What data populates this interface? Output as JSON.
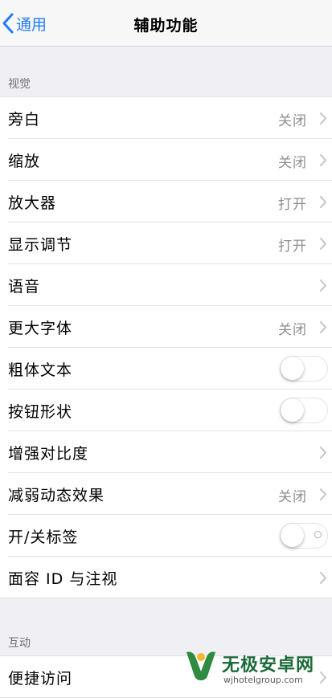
{
  "navbar": {
    "back_label": "通用",
    "title": "辅助功能"
  },
  "sections": {
    "vision_header": "视觉",
    "interaction_header": "互动"
  },
  "vision_rows": [
    {
      "label": "旁白",
      "value": "关闭",
      "accessory": "chevron"
    },
    {
      "label": "缩放",
      "value": "关闭",
      "accessory": "chevron"
    },
    {
      "label": "放大器",
      "value": "打开",
      "accessory": "chevron"
    },
    {
      "label": "显示调节",
      "value": "打开",
      "accessory": "chevron"
    },
    {
      "label": "语音",
      "value": "",
      "accessory": "chevron"
    },
    {
      "label": "更大字体",
      "value": "关闭",
      "accessory": "chevron"
    },
    {
      "label": "粗体文本",
      "value": "",
      "accessory": "toggle",
      "on": false
    },
    {
      "label": "按钮形状",
      "value": "",
      "accessory": "toggle",
      "on": false
    },
    {
      "label": "增强对比度",
      "value": "",
      "accessory": "chevron"
    },
    {
      "label": "减弱动态效果",
      "value": "关闭",
      "accessory": "chevron"
    },
    {
      "label": "开/关标签",
      "value": "",
      "accessory": "toggle",
      "on": false
    },
    {
      "label": "面容 ID 与注视",
      "value": "",
      "accessory": "chevron"
    }
  ],
  "interaction_rows": [
    {
      "label": "便捷访问",
      "value": "",
      "accessory": "chevron"
    }
  ],
  "watermark": {
    "title": "无极安卓网",
    "url": "wjhotelgroup.com"
  },
  "colors": {
    "accent": "#1f7cf6",
    "background": "#efeff4",
    "secondary_text": "#8e8e93",
    "watermark_green": "#1d6b3a"
  }
}
